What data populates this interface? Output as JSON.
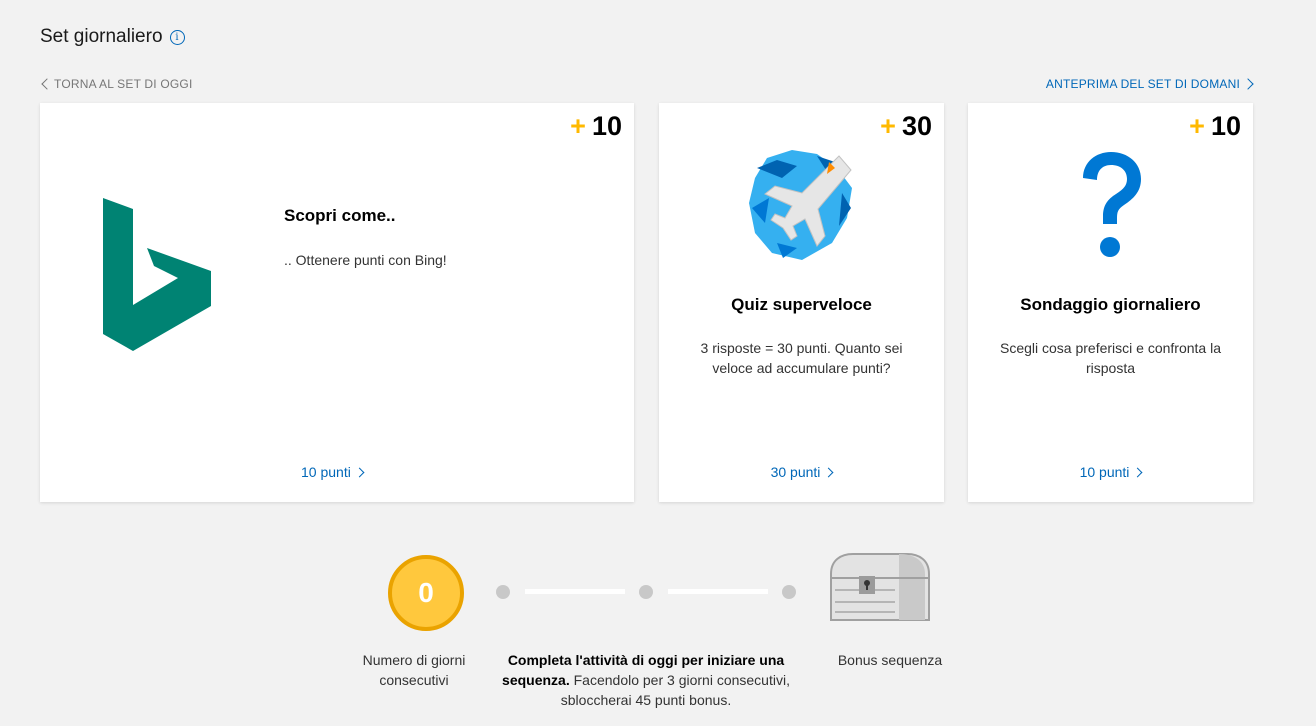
{
  "header": {
    "title": "Set giornaliero",
    "info_icon": "info-icon"
  },
  "nav": {
    "back_label": "TORNA AL SET DI OGGI",
    "next_label": "ANTEPRIMA DEL SET DI DOMANI"
  },
  "cards": [
    {
      "points_plus": "+",
      "points": "10",
      "title": "Scopri come..",
      "description": ".. Ottenere punti con Bing!",
      "link": "10 punti",
      "image": "bing-logo"
    },
    {
      "points_plus": "+",
      "points": "30",
      "title": "Quiz superveloce",
      "description": "3 risposte = 30 punti. Quanto sei veloce ad accumulare punti?",
      "link": "30 punti",
      "image": "jet-plane-icon"
    },
    {
      "points_plus": "+",
      "points": "10",
      "title": "Sondaggio giornaliero",
      "description": "Scegli cosa preferisci e confronta la risposta",
      "link": "10 punti",
      "image": "question-mark-icon"
    }
  ],
  "streak": {
    "count": "0",
    "count_label": "Numero di giorni consecutivi",
    "message_bold": "Completa l'attività di oggi per iniziare una sequenza.",
    "message_rest": " Facendolo per 3 giorni consecutivi, sbloccherai 45 punti bonus.",
    "bonus_label": "Bonus sequenza",
    "bonus_icon": "treasure-chest-icon",
    "progress_days_completed": 0,
    "progress_days_total": 3
  },
  "colors": {
    "accent": "#0067b8",
    "points_plus": "#ffb900",
    "bing_green": "#008373",
    "coin": "#ffc83d",
    "background": "#f2f2f2"
  }
}
